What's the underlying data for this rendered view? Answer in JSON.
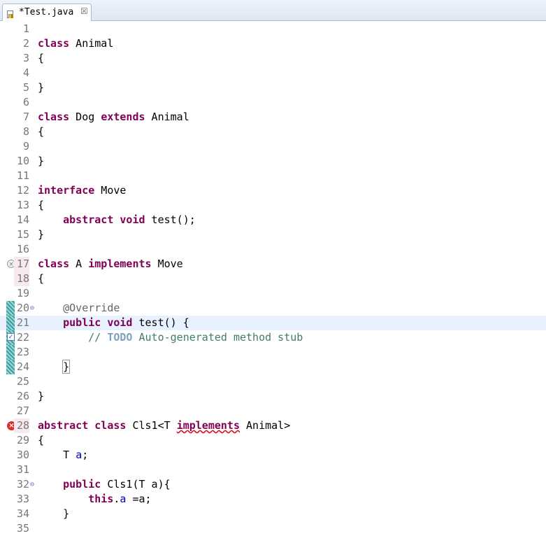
{
  "tab": {
    "title": "*Test.java",
    "close": "☒"
  },
  "editor": {
    "lines": [
      {
        "n": "1",
        "tokens": []
      },
      {
        "n": "2",
        "tokens": [
          {
            "t": "class",
            "c": "kw"
          },
          {
            "t": " Animal"
          }
        ]
      },
      {
        "n": "3",
        "tokens": [
          {
            "t": "{"
          }
        ]
      },
      {
        "n": "4",
        "tokens": []
      },
      {
        "n": "5",
        "tokens": [
          {
            "t": "}"
          }
        ]
      },
      {
        "n": "6",
        "tokens": []
      },
      {
        "n": "7",
        "tokens": [
          {
            "t": "class",
            "c": "kw"
          },
          {
            "t": " Dog "
          },
          {
            "t": "extends",
            "c": "kw"
          },
          {
            "t": " Animal"
          }
        ]
      },
      {
        "n": "8",
        "tokens": [
          {
            "t": "{"
          }
        ]
      },
      {
        "n": "9",
        "tokens": []
      },
      {
        "n": "10",
        "tokens": [
          {
            "t": "}"
          }
        ]
      },
      {
        "n": "11",
        "tokens": []
      },
      {
        "n": "12",
        "tokens": [
          {
            "t": "interface",
            "c": "kw"
          },
          {
            "t": " Move"
          }
        ]
      },
      {
        "n": "13",
        "tokens": [
          {
            "t": "{"
          }
        ]
      },
      {
        "n": "14",
        "tokens": [
          {
            "t": "    "
          },
          {
            "t": "abstract",
            "c": "kw"
          },
          {
            "t": " "
          },
          {
            "t": "void",
            "c": "kw"
          },
          {
            "t": " test();"
          }
        ]
      },
      {
        "n": "15",
        "tokens": [
          {
            "t": "}"
          }
        ]
      },
      {
        "n": "16",
        "tokens": []
      },
      {
        "n": "17",
        "tokens": [
          {
            "t": "class",
            "c": "kw"
          },
          {
            "t": " A "
          },
          {
            "t": "implements",
            "c": "kw"
          },
          {
            "t": " Move"
          }
        ],
        "gutter": "warn",
        "lnErr": true
      },
      {
        "n": "18",
        "tokens": [
          {
            "t": "{"
          }
        ],
        "lnErr": true
      },
      {
        "n": "19",
        "tokens": []
      },
      {
        "n": "20",
        "tokens": [
          {
            "t": "    "
          },
          {
            "t": "@Override",
            "c": "ann"
          }
        ],
        "marker": true,
        "fold": true
      },
      {
        "n": "21",
        "tokens": [
          {
            "t": "    "
          },
          {
            "t": "public",
            "c": "kw"
          },
          {
            "t": " "
          },
          {
            "t": "void",
            "c": "kw"
          },
          {
            "t": " test() {"
          }
        ],
        "marker": true,
        "current": true
      },
      {
        "n": "22",
        "tokens": [
          {
            "t": "        "
          },
          {
            "t": "// ",
            "c": "cmt"
          },
          {
            "t": "TODO",
            "c": "todo"
          },
          {
            "t": " Auto-generated method stub",
            "c": "cmt"
          }
        ],
        "marker": true,
        "gutter": "task"
      },
      {
        "n": "23",
        "tokens": [],
        "marker": true
      },
      {
        "n": "24",
        "tokens": [
          {
            "t": "    "
          },
          {
            "t": "}",
            "c": "bracket"
          }
        ],
        "marker": true
      },
      {
        "n": "25",
        "tokens": []
      },
      {
        "n": "26",
        "tokens": [
          {
            "t": "}"
          }
        ]
      },
      {
        "n": "27",
        "tokens": []
      },
      {
        "n": "28",
        "tokens": [
          {
            "t": "abstract",
            "c": "kw"
          },
          {
            "t": " "
          },
          {
            "t": "class",
            "c": "kw"
          },
          {
            "t": " Cls1<T "
          },
          {
            "t": "implements",
            "c": "kw squig"
          },
          {
            "t": " Animal>"
          }
        ],
        "gutter": "error",
        "lnErr": true
      },
      {
        "n": "29",
        "tokens": [
          {
            "t": "{"
          }
        ]
      },
      {
        "n": "30",
        "tokens": [
          {
            "t": "    T "
          },
          {
            "t": "a",
            "c": "fld"
          },
          {
            "t": ";"
          }
        ]
      },
      {
        "n": "31",
        "tokens": []
      },
      {
        "n": "32",
        "tokens": [
          {
            "t": "    "
          },
          {
            "t": "public",
            "c": "kw"
          },
          {
            "t": " Cls1(T a){"
          }
        ],
        "fold": true
      },
      {
        "n": "33",
        "tokens": [
          {
            "t": "        "
          },
          {
            "t": "this",
            "c": "kw"
          },
          {
            "t": "."
          },
          {
            "t": "a",
            "c": "fld"
          },
          {
            "t": " =a;"
          }
        ]
      },
      {
        "n": "34",
        "tokens": [
          {
            "t": "    }"
          }
        ]
      },
      {
        "n": "35",
        "tokens": []
      }
    ]
  },
  "icons": {
    "file": "java-file-icon",
    "error": "error-icon",
    "warning": "warning-icon",
    "task": "task-icon",
    "fold": "fold-minus-icon"
  },
  "colors": {
    "keyword": "#7f0055",
    "comment": "#3f7f5f",
    "field": "#0000c0",
    "annotation": "#646464",
    "todo": "#7f9fbf",
    "current_line": "#e8f2fe"
  }
}
